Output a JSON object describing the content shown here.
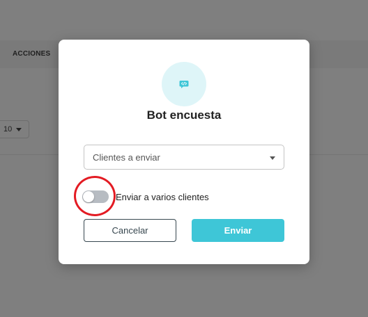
{
  "background": {
    "column_header": "ACCIONES",
    "pager_value": "10"
  },
  "modal": {
    "icon": "chat-code-icon",
    "title": "Bot encuesta",
    "select": {
      "placeholder": "Clientes a enviar"
    },
    "toggle": {
      "label": "Enviar a varios clientes",
      "checked": false
    },
    "buttons": {
      "cancel": "Cancelar",
      "send": "Enviar"
    }
  },
  "colors": {
    "accent": "#3ec6d7",
    "icon_bg": "#def5f8",
    "highlight": "#e31b23"
  }
}
